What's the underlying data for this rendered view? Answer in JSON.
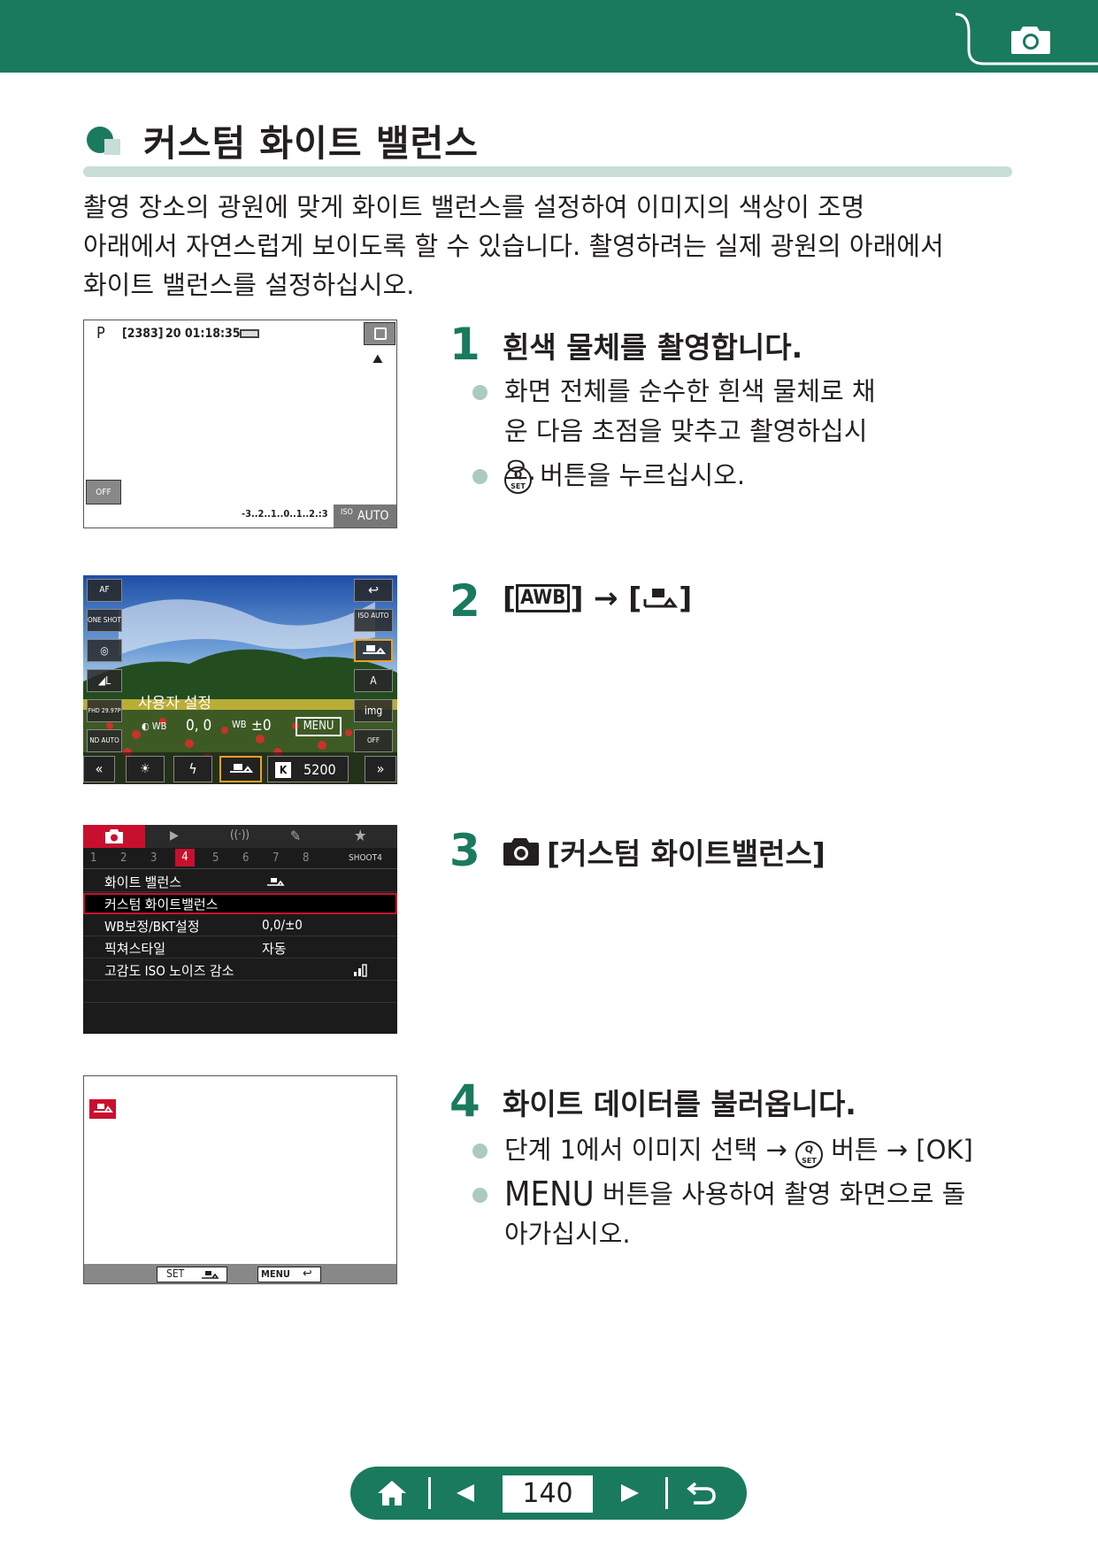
{
  "header": {
    "icon": "camera-icon",
    "band_color": "#1a7a5e"
  },
  "section": {
    "title": "커스텀 화이트 밸런스"
  },
  "intro": {
    "lines": [
      "촬영 장소의 광원에 맞게 화이트 밸런스를 설정하여 이미지의 색상이 조명",
      "아래에서 자연스럽게 보이도록 할 수 있습니다. 촬영하려는 실제 광원의 아래에서",
      "화이트 밸런스를 설정하십시오."
    ]
  },
  "screen1": {
    "mode": "P",
    "shots": "[2383]",
    "time": "20 01:18:35",
    "exposure_scale": "-3..2..1..0..1..2.:3",
    "iso": "AUTO",
    "icons": [
      "battery-icon",
      "quick-control-icon",
      "scene-icon",
      "touch-shutter-off-icon"
    ]
  },
  "screen2": {
    "left_column": [
      "AF",
      "ONE SHOT",
      "◎",
      "◢L",
      "FHD 29.97P",
      "ND AUTO"
    ],
    "right_column": [
      "↩",
      "ISO AUTO",
      "custom-wb",
      "A",
      "img",
      "OFF"
    ],
    "panel_title": "사용자 설정",
    "wb_values": "0,  0",
    "bracket": "±0",
    "menu_label": "MENU",
    "bottom": [
      "«",
      "☀",
      "ϟ",
      "custom-wb",
      "K",
      "5200",
      "»"
    ]
  },
  "screen3": {
    "tab_numbers": [
      "1",
      "2",
      "3",
      "4",
      "5",
      "6",
      "7",
      "8"
    ],
    "active_tab": "4",
    "tab_name": "SHOOT4",
    "rows": [
      {
        "label": "화이트 밸런스",
        "value": ""
      },
      {
        "label": "커스텀 화이트밸런스",
        "value": ""
      },
      {
        "label": "WB보정/BKT설정",
        "value": "0,0/±0"
      },
      {
        "label": "픽쳐스타일",
        "value": "자동"
      },
      {
        "label": "고감도 ISO 노이즈 감소",
        "value": ""
      }
    ]
  },
  "screen4": {
    "set_label": "SET",
    "menu_label": "MENU"
  },
  "steps": [
    {
      "number": "1",
      "title": "흰색 물체를 촬영합니다.",
      "bullets": [
        "화면 전체를 순수한 흰색 물체로 채운 다음 초점을 맞추고 촬영하십시오.",
        "버튼을 누르십시오."
      ]
    },
    {
      "number": "2",
      "title_parts": [
        "[",
        "AWB",
        "] → [",
        "]"
      ]
    },
    {
      "number": "3",
      "title": "[커스텀 화이트밸런스]"
    },
    {
      "number": "4",
      "title": "화이트 데이터를 불러옵니다.",
      "bullets": [
        {
          "before": "단계 1에서 이미지 선택 →",
          "after": "버튼 → [OK]"
        },
        {
          "menu": "MENU",
          "text": "버튼을 사용하여 촬영 화면으로 돌아가십시오."
        }
      ]
    }
  ],
  "qset": {
    "top": "Q",
    "bottom": "SET"
  },
  "nav": {
    "page": "140",
    "items": [
      "home-icon",
      "prev-icon",
      "next-icon",
      "back-icon"
    ]
  }
}
